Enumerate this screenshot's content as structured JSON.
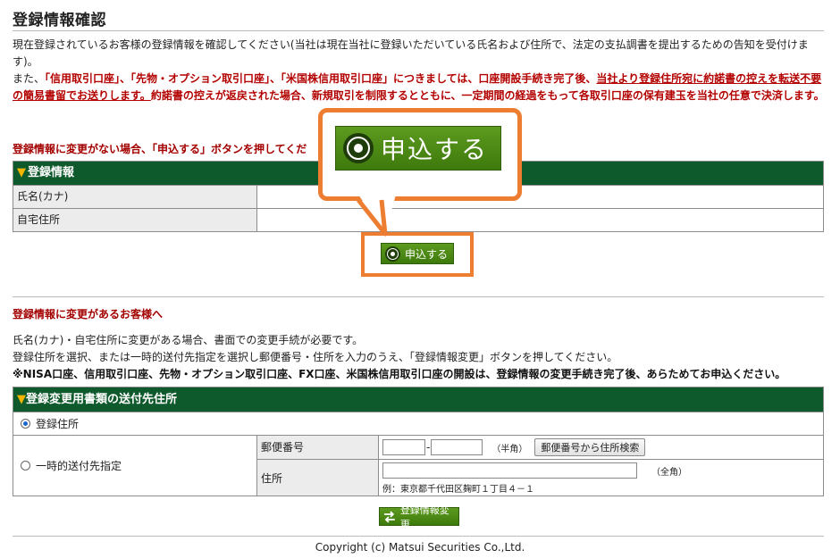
{
  "page": {
    "title": "登録情報確認"
  },
  "intro": {
    "line1": "現在登録されているお客様の登録情報を確認してください(当社は現在当社に登録いただいている氏名および住所で、法定の支払調書を提出するための告知を受付けます)。",
    "line2_prefix": "また、",
    "accounts": "「信用取引口座」、「先物・オプション取引口座」、「米国株信用取引口座」につきましては、口座開設手続き完了後、",
    "underline": "当社より登録住所宛に約諾書の控えを転送不要の簡易書留でお送りします。",
    "rest": "約諾書の控えが返戻された場合、新規取引を制限するとともに、一定期間の経過をもって各取引口座の保有建玉を当社の任意で決済します。"
  },
  "no_change": {
    "heading": "登録情報に変更がない場合、「申込する」ボタンを押してくだ",
    "table_title": "登録情報",
    "rows": [
      {
        "label": "氏名(カナ)",
        "value": ""
      },
      {
        "label": "自宅住所",
        "value": ""
      }
    ],
    "apply_label": "申込する"
  },
  "callout": {
    "apply_label": "申込する"
  },
  "change": {
    "heading": "登録情報に変更があるお客様へ",
    "line1": "氏名(カナ)・自宅住所に変更がある場合、書面での変更手続が必要です。",
    "line2": "登録住所を選択、または一時的送付先指定を選択し郵便番号・住所を入力のうえ、「登録情報変更」ボタンを押してください。",
    "note": "※NISA口座、信用取引口座、先物・オプション取引口座、FX口座、米国株信用取引口座の開設は、登録情報の変更手続き完了後、あらためてお申込ください。",
    "table_title": "登録変更用書類の送付先住所",
    "registered_label": "登録住所",
    "temporary_label": "一時的送付先指定",
    "postal_label": "郵便番号",
    "postal_hint": "（半角）",
    "postal_value1": "",
    "postal_value2": "",
    "postal_sep": "-",
    "postal_search": "郵便番号から住所検索",
    "address_label": "住所",
    "address_value": "",
    "address_hint": "（全角）",
    "address_example": "例：東京都千代田区麹町１丁目４－１",
    "submit_label": "登録情報変更"
  },
  "footer": {
    "copyright": "Copyright (c) Matsui Securities Co.,Ltd."
  },
  "icons": {
    "triangle": "▼",
    "apply": "target-circle-icon",
    "swap": "swap-arrows-icon"
  },
  "colors": {
    "green_header": "#0f5a2c",
    "button_green": "#4d8a15",
    "accent_red": "#b30000",
    "callout_orange": "#ed7d31"
  }
}
